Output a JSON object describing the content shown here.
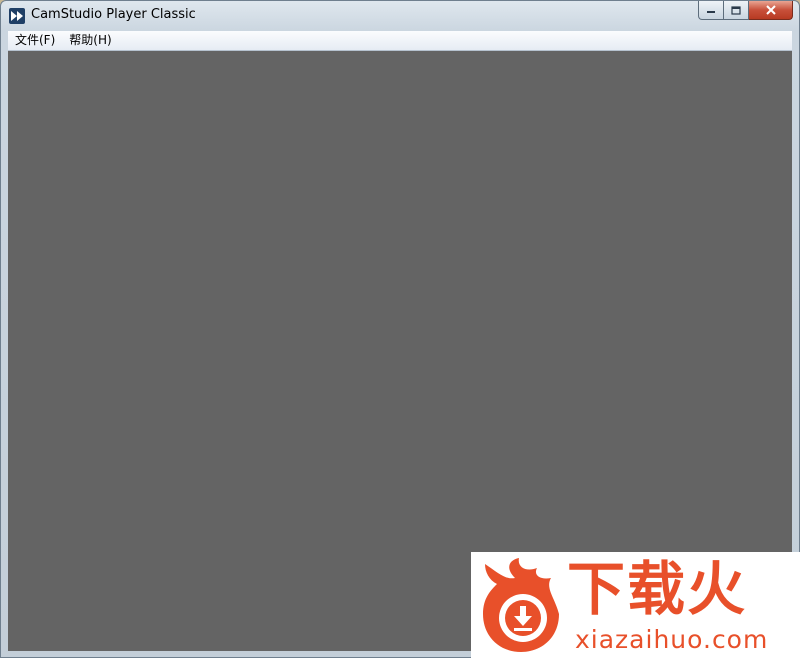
{
  "window": {
    "title": "CamStudio Player Classic"
  },
  "menu": {
    "items": [
      {
        "label": "文件(F)"
      },
      {
        "label": "帮助(H)"
      }
    ]
  },
  "watermark": {
    "brand_cn": "下载火",
    "domain": "xiazaihuo.com"
  },
  "colors": {
    "client_background": "#646464",
    "watermark_accent": "#e8502a"
  },
  "icons": {
    "app": "fast-forward-icon",
    "minimize": "minimize-icon",
    "maximize": "maximize-icon",
    "close": "close-icon"
  }
}
